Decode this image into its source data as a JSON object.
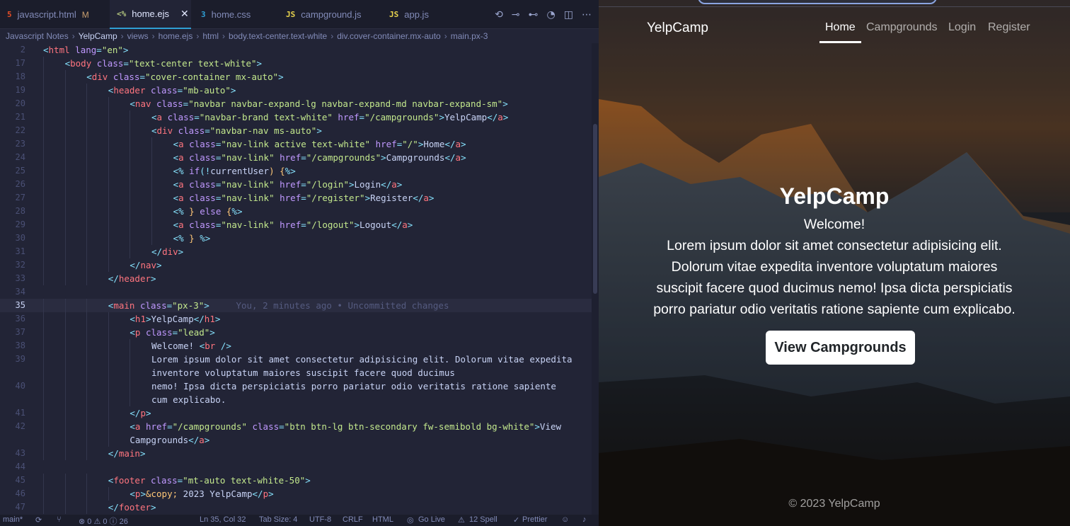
{
  "editor": {
    "tabs": [
      {
        "icon": "5",
        "icon_color": "#e44d26",
        "name": "javascript.html",
        "badge": "M",
        "active": false
      },
      {
        "icon": "<%",
        "icon_color": "#b4c67f",
        "name": "home.ejs",
        "badge": "",
        "active": true
      },
      {
        "icon": "3",
        "icon_color": "#2f9fd4",
        "name": "home.css",
        "badge": "",
        "active": false
      },
      {
        "icon": "JS",
        "icon_color": "#e8d44d",
        "name": "campground.js",
        "badge": "",
        "active": false
      },
      {
        "icon": "JS",
        "icon_color": "#e8d44d",
        "name": "app.js",
        "badge": "",
        "active": false
      }
    ],
    "breadcrumb": [
      "Javascript Notes",
      "YelpCamp",
      "views",
      "home.ejs",
      "html",
      "body.text-center.text-white",
      "div.cover-container.mx-auto",
      "main.px-3"
    ],
    "lines": [
      {
        "n": "2",
        "indent": 0,
        "segs": [
          [
            "<",
            "#86e1fc"
          ],
          [
            "html",
            "#ff757f"
          ],
          [
            " lang",
            "#c099ff"
          ],
          [
            "=",
            "#86e1fc"
          ],
          [
            "\"en\"",
            "#c3e88d"
          ],
          [
            ">",
            "#86e1fc"
          ]
        ]
      },
      {
        "n": "17",
        "indent": 1,
        "segs": [
          [
            "<",
            "#86e1fc"
          ],
          [
            "body",
            "#ff757f"
          ],
          [
            " class",
            "#c099ff"
          ],
          [
            "=",
            "#86e1fc"
          ],
          [
            "\"text-center text-white\"",
            "#c3e88d"
          ],
          [
            ">",
            "#86e1fc"
          ]
        ]
      },
      {
        "n": "18",
        "indent": 2,
        "segs": [
          [
            "<",
            "#86e1fc"
          ],
          [
            "div",
            "#ff757f"
          ],
          [
            " class",
            "#c099ff"
          ],
          [
            "=",
            "#86e1fc"
          ],
          [
            "\"cover-container mx-auto\"",
            "#c3e88d"
          ],
          [
            ">",
            "#86e1fc"
          ]
        ]
      },
      {
        "n": "19",
        "indent": 3,
        "segs": [
          [
            "<",
            "#86e1fc"
          ],
          [
            "header",
            "#ff757f"
          ],
          [
            " class",
            "#c099ff"
          ],
          [
            "=",
            "#86e1fc"
          ],
          [
            "\"mb-auto\"",
            "#c3e88d"
          ],
          [
            ">",
            "#86e1fc"
          ]
        ]
      },
      {
        "n": "20",
        "indent": 4,
        "segs": [
          [
            "<",
            "#86e1fc"
          ],
          [
            "nav",
            "#ff757f"
          ],
          [
            " class",
            "#c099ff"
          ],
          [
            "=",
            "#86e1fc"
          ],
          [
            "\"navbar navbar-expand-lg navbar-expand-md navbar-expand-sm\"",
            "#c3e88d"
          ],
          [
            ">",
            "#86e1fc"
          ]
        ]
      },
      {
        "n": "21",
        "indent": 5,
        "segs": [
          [
            "<",
            "#86e1fc"
          ],
          [
            "a",
            "#ff757f"
          ],
          [
            " class",
            "#c099ff"
          ],
          [
            "=",
            "#86e1fc"
          ],
          [
            "\"navbar-brand text-white\"",
            "#c3e88d"
          ],
          [
            " href",
            "#c099ff"
          ],
          [
            "=",
            "#86e1fc"
          ],
          [
            "\"/campgrounds\"",
            "#c3e88d"
          ],
          [
            ">",
            "#86e1fc"
          ],
          [
            "YelpCamp",
            "#c8d3f5"
          ],
          [
            "</",
            "#86e1fc"
          ],
          [
            "a",
            "#ff757f"
          ],
          [
            ">",
            "#86e1fc"
          ]
        ]
      },
      {
        "n": "22",
        "indent": 5,
        "segs": [
          [
            "<",
            "#86e1fc"
          ],
          [
            "div",
            "#ff757f"
          ],
          [
            " class",
            "#c099ff"
          ],
          [
            "=",
            "#86e1fc"
          ],
          [
            "\"navbar-nav ms-auto\"",
            "#c3e88d"
          ],
          [
            ">",
            "#86e1fc"
          ]
        ]
      },
      {
        "n": "23",
        "indent": 6,
        "segs": [
          [
            "<",
            "#86e1fc"
          ],
          [
            "a",
            "#ff757f"
          ],
          [
            " class",
            "#c099ff"
          ],
          [
            "=",
            "#86e1fc"
          ],
          [
            "\"nav-link active text-white\"",
            "#c3e88d"
          ],
          [
            " href",
            "#c099ff"
          ],
          [
            "=",
            "#86e1fc"
          ],
          [
            "\"/\"",
            "#c3e88d"
          ],
          [
            ">",
            "#86e1fc"
          ],
          [
            "Home",
            "#c8d3f5"
          ],
          [
            "</",
            "#86e1fc"
          ],
          [
            "a",
            "#ff757f"
          ],
          [
            ">",
            "#86e1fc"
          ]
        ]
      },
      {
        "n": "24",
        "indent": 6,
        "segs": [
          [
            "<",
            "#86e1fc"
          ],
          [
            "a",
            "#ff757f"
          ],
          [
            " class",
            "#c099ff"
          ],
          [
            "=",
            "#86e1fc"
          ],
          [
            "\"nav-link\"",
            "#c3e88d"
          ],
          [
            " href",
            "#c099ff"
          ],
          [
            "=",
            "#86e1fc"
          ],
          [
            "\"/campgrounds\"",
            "#c3e88d"
          ],
          [
            ">",
            "#86e1fc"
          ],
          [
            "Campgrounds",
            "#c8d3f5"
          ],
          [
            "</",
            "#86e1fc"
          ],
          [
            "a",
            "#ff757f"
          ],
          [
            ">",
            "#86e1fc"
          ]
        ]
      },
      {
        "n": "25",
        "indent": 6,
        "segs": [
          [
            "<%",
            "#86e1fc"
          ],
          [
            " if",
            "#c099ff"
          ],
          [
            "(!",
            "#86e1fc"
          ],
          [
            "currentUser",
            "#c8d3f5"
          ],
          [
            ")",
            "#ffc777"
          ],
          [
            " {",
            "#ffc777"
          ],
          [
            "%>",
            "#86e1fc"
          ]
        ]
      },
      {
        "n": "26",
        "indent": 6,
        "segs": [
          [
            "<",
            "#86e1fc"
          ],
          [
            "a",
            "#ff757f"
          ],
          [
            " class",
            "#c099ff"
          ],
          [
            "=",
            "#86e1fc"
          ],
          [
            "\"nav-link\"",
            "#c3e88d"
          ],
          [
            " href",
            "#c099ff"
          ],
          [
            "=",
            "#86e1fc"
          ],
          [
            "\"/login\"",
            "#c3e88d"
          ],
          [
            ">",
            "#86e1fc"
          ],
          [
            "Login",
            "#c8d3f5"
          ],
          [
            "</",
            "#86e1fc"
          ],
          [
            "a",
            "#ff757f"
          ],
          [
            ">",
            "#86e1fc"
          ]
        ]
      },
      {
        "n": "27",
        "indent": 6,
        "segs": [
          [
            "<",
            "#86e1fc"
          ],
          [
            "a",
            "#ff757f"
          ],
          [
            " class",
            "#c099ff"
          ],
          [
            "=",
            "#86e1fc"
          ],
          [
            "\"nav-link\"",
            "#c3e88d"
          ],
          [
            " href",
            "#c099ff"
          ],
          [
            "=",
            "#86e1fc"
          ],
          [
            "\"/register\"",
            "#c3e88d"
          ],
          [
            ">",
            "#86e1fc"
          ],
          [
            "Register",
            "#c8d3f5"
          ],
          [
            "</",
            "#86e1fc"
          ],
          [
            "a",
            "#ff757f"
          ],
          [
            ">",
            "#86e1fc"
          ]
        ]
      },
      {
        "n": "28",
        "indent": 6,
        "segs": [
          [
            "<%",
            "#86e1fc"
          ],
          [
            " }",
            "#ffc777"
          ],
          [
            " else",
            "#c099ff"
          ],
          [
            " {",
            "#ffc777"
          ],
          [
            "%>",
            "#86e1fc"
          ]
        ]
      },
      {
        "n": "29",
        "indent": 6,
        "segs": [
          [
            "<",
            "#86e1fc"
          ],
          [
            "a",
            "#ff757f"
          ],
          [
            " class",
            "#c099ff"
          ],
          [
            "=",
            "#86e1fc"
          ],
          [
            "\"nav-link\"",
            "#c3e88d"
          ],
          [
            " href",
            "#c099ff"
          ],
          [
            "=",
            "#86e1fc"
          ],
          [
            "\"/logout\"",
            "#c3e88d"
          ],
          [
            ">",
            "#86e1fc"
          ],
          [
            "Logout",
            "#c8d3f5"
          ],
          [
            "</",
            "#86e1fc"
          ],
          [
            "a",
            "#ff757f"
          ],
          [
            ">",
            "#86e1fc"
          ]
        ]
      },
      {
        "n": "30",
        "indent": 6,
        "segs": [
          [
            "<%",
            "#86e1fc"
          ],
          [
            " }",
            "#ffc777"
          ],
          [
            " %>",
            "#86e1fc"
          ]
        ]
      },
      {
        "n": "31",
        "indent": 5,
        "segs": [
          [
            "</",
            "#86e1fc"
          ],
          [
            "div",
            "#ff757f"
          ],
          [
            ">",
            "#86e1fc"
          ]
        ]
      },
      {
        "n": "32",
        "indent": 4,
        "segs": [
          [
            "</",
            "#86e1fc"
          ],
          [
            "nav",
            "#ff757f"
          ],
          [
            ">",
            "#86e1fc"
          ]
        ]
      },
      {
        "n": "33",
        "indent": 3,
        "segs": [
          [
            "</",
            "#86e1fc"
          ],
          [
            "header",
            "#ff757f"
          ],
          [
            ">",
            "#86e1fc"
          ]
        ]
      },
      {
        "n": "34",
        "indent": 0,
        "segs": []
      },
      {
        "n": "35",
        "indent": 3,
        "current": true,
        "segs": [
          [
            "<",
            "#86e1fc"
          ],
          [
            "main",
            "#ff757f"
          ],
          [
            " class",
            "#c099ff"
          ],
          [
            "=",
            "#86e1fc"
          ],
          [
            "\"px-3\"",
            "#c3e88d"
          ],
          [
            ">",
            "#86e1fc"
          ],
          [
            "     You, 2 minutes ago • Uncommitted changes",
            "#555b80"
          ]
        ]
      },
      {
        "n": "36",
        "indent": 4,
        "segs": [
          [
            "<",
            "#86e1fc"
          ],
          [
            "h1",
            "#ff757f"
          ],
          [
            ">",
            "#86e1fc"
          ],
          [
            "YelpCamp",
            "#c8d3f5"
          ],
          [
            "</",
            "#86e1fc"
          ],
          [
            "h1",
            "#ff757f"
          ],
          [
            ">",
            "#86e1fc"
          ]
        ]
      },
      {
        "n": "37",
        "indent": 4,
        "segs": [
          [
            "<",
            "#86e1fc"
          ],
          [
            "p",
            "#ff757f"
          ],
          [
            " class",
            "#c099ff"
          ],
          [
            "=",
            "#86e1fc"
          ],
          [
            "\"lead\"",
            "#c3e88d"
          ],
          [
            ">",
            "#86e1fc"
          ]
        ]
      },
      {
        "n": "38",
        "indent": 5,
        "segs": [
          [
            "Welcome! ",
            "#c8d3f5"
          ],
          [
            "<",
            "#86e1fc"
          ],
          [
            "br",
            "#ff757f"
          ],
          [
            " />",
            "#86e1fc"
          ]
        ]
      },
      {
        "n": "39",
        "indent": 5,
        "segs": [
          [
            "Lorem ipsum dolor sit amet consectetur adipisicing elit. Dolorum vitae expedita",
            "#c8d3f5"
          ]
        ]
      },
      {
        "n": "",
        "indent": 5,
        "segs": [
          [
            "inventore voluptatum maiores suscipit facere quod ducimus",
            "#c8d3f5"
          ]
        ]
      },
      {
        "n": "40",
        "indent": 5,
        "segs": [
          [
            "nemo! Ipsa dicta perspiciatis porro pariatur odio veritatis ratione sapiente",
            "#c8d3f5"
          ]
        ]
      },
      {
        "n": "",
        "indent": 5,
        "segs": [
          [
            "cum explicabo.",
            "#c8d3f5"
          ]
        ]
      },
      {
        "n": "41",
        "indent": 4,
        "segs": [
          [
            "</",
            "#86e1fc"
          ],
          [
            "p",
            "#ff757f"
          ],
          [
            ">",
            "#86e1fc"
          ]
        ]
      },
      {
        "n": "42",
        "indent": 4,
        "segs": [
          [
            "<",
            "#86e1fc"
          ],
          [
            "a",
            "#ff757f"
          ],
          [
            " href",
            "#c099ff"
          ],
          [
            "=",
            "#86e1fc"
          ],
          [
            "\"/campgrounds\"",
            "#c3e88d"
          ],
          [
            " class",
            "#c099ff"
          ],
          [
            "=",
            "#86e1fc"
          ],
          [
            "\"btn btn-lg btn-secondary fw-semibold bg-white\"",
            "#c3e88d"
          ],
          [
            ">",
            "#86e1fc"
          ],
          [
            "View",
            "#c8d3f5"
          ]
        ]
      },
      {
        "n": "",
        "indent": 4,
        "segs": [
          [
            "Campgrounds",
            "#c8d3f5"
          ],
          [
            "</",
            "#86e1fc"
          ],
          [
            "a",
            "#ff757f"
          ],
          [
            ">",
            "#86e1fc"
          ]
        ]
      },
      {
        "n": "43",
        "indent": 3,
        "segs": [
          [
            "</",
            "#86e1fc"
          ],
          [
            "main",
            "#ff757f"
          ],
          [
            ">",
            "#86e1fc"
          ]
        ]
      },
      {
        "n": "44",
        "indent": 0,
        "segs": []
      },
      {
        "n": "45",
        "indent": 3,
        "segs": [
          [
            "<",
            "#86e1fc"
          ],
          [
            "footer",
            "#ff757f"
          ],
          [
            " class",
            "#c099ff"
          ],
          [
            "=",
            "#86e1fc"
          ],
          [
            "\"mt-auto text-white-50\"",
            "#c3e88d"
          ],
          [
            ">",
            "#86e1fc"
          ]
        ]
      },
      {
        "n": "46",
        "indent": 4,
        "segs": [
          [
            "<",
            "#86e1fc"
          ],
          [
            "p",
            "#ff757f"
          ],
          [
            ">",
            "#86e1fc"
          ],
          [
            "&copy;",
            "#ffc777"
          ],
          [
            " 2023 YelpCamp",
            "#c8d3f5"
          ],
          [
            "</",
            "#86e1fc"
          ],
          [
            "p",
            "#ff757f"
          ],
          [
            ">",
            "#86e1fc"
          ]
        ]
      },
      {
        "n": "47",
        "indent": 3,
        "segs": [
          [
            "</",
            "#86e1fc"
          ],
          [
            "footer",
            "#ff757f"
          ],
          [
            ">",
            "#86e1fc"
          ]
        ]
      }
    ],
    "status": {
      "branch": "main*",
      "problems": "⊗ 0 ⚠ 0 ⓘ 26",
      "cursor": "Ln 35, Col 32",
      "tab_size": "Tab Size: 4",
      "encoding": "UTF-8",
      "eol": "CRLF",
      "language": "HTML",
      "golive": "Go Live",
      "spell": "12 Spell",
      "prettier": "Prettier"
    }
  },
  "preview": {
    "brand": "YelpCamp",
    "nav": [
      "Home",
      "Campgrounds",
      "Login",
      "Register"
    ],
    "title": "YelpCamp",
    "lead_lines": [
      "Welcome!",
      "Lorem ipsum dolor sit amet consectetur adipisicing elit.",
      "Dolorum vitae expedita inventore voluptatum maiores",
      "suscipit facere quod ducimus nemo! Ipsa dicta perspiciatis",
      "porro pariatur odio veritatis ratione sapiente cum explicabo."
    ],
    "cta": "View Campgrounds",
    "footer": "© 2023 YelpCamp"
  }
}
